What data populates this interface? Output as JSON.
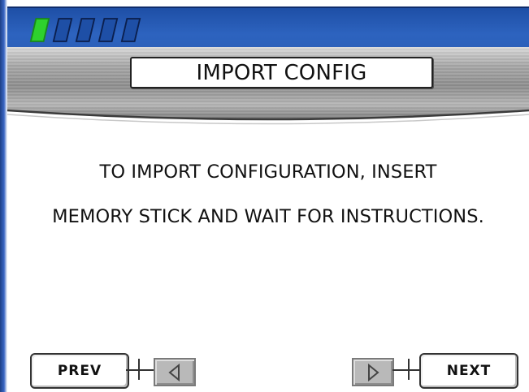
{
  "screen": {
    "title": "IMPORT CONFIG",
    "instruction_line1": "TO IMPORT CONFIGURATION, INSERT",
    "instruction_line2": "MEMORY STICK AND WAIT FOR INSTRUCTIONS."
  },
  "progress": {
    "steps_total": 5,
    "steps_done": 1,
    "active_color": "#2ed12e",
    "inactive_color": "#1e4fa6"
  },
  "nav": {
    "prev_label": "PREV",
    "next_label": "NEXT",
    "prev_arrow_icon": "triangle-left-icon",
    "next_arrow_icon": "triangle-right-icon"
  },
  "colors": {
    "top_bar": "#2d63bf",
    "metal_band": "#9a9a9a",
    "arrow_button": "#b9b9b9"
  }
}
